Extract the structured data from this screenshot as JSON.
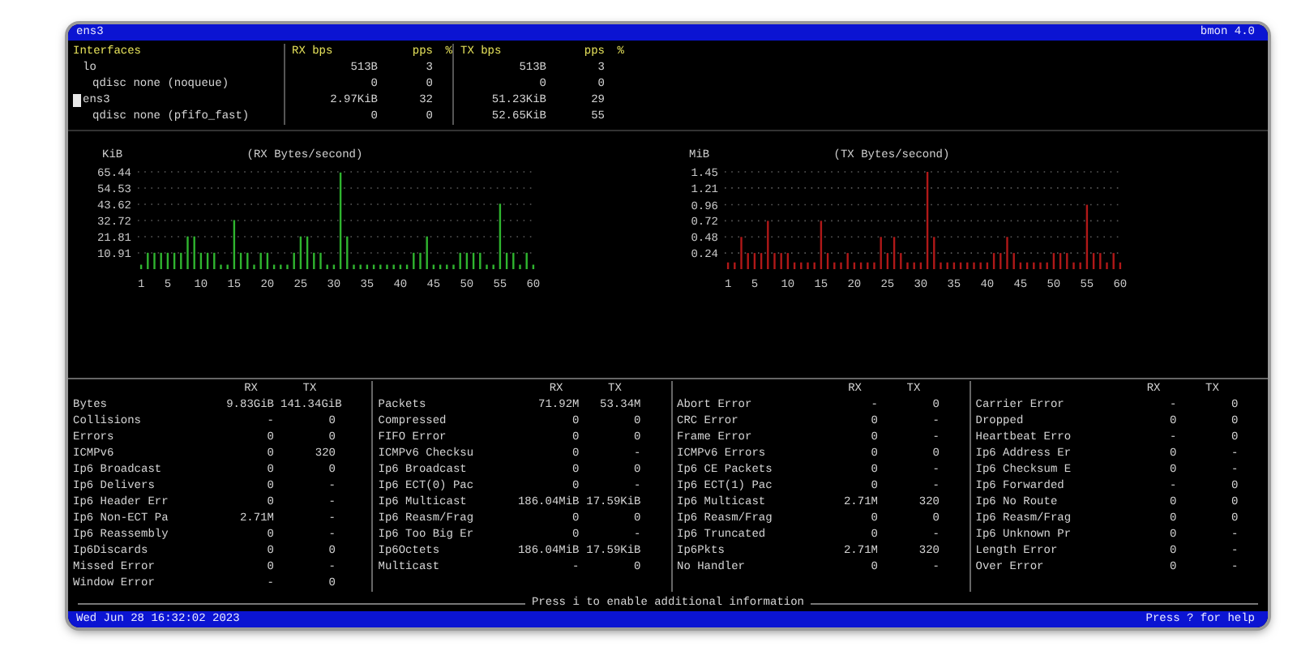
{
  "window": {
    "title": "ens3",
    "app": "bmon 4.0"
  },
  "interfaces": {
    "columns": [
      "Interfaces",
      "RX bps",
      "pps",
      "%",
      "TX bps",
      "pps",
      "%"
    ],
    "rows": [
      {
        "name": "lo",
        "selected": false,
        "rx_bps": "513B",
        "rx_pps": "3",
        "tx_bps": "513B",
        "tx_pps": "3",
        "children": [
          {
            "name": "qdisc none (noqueue)",
            "rx_bps": "0",
            "rx_pps": "0",
            "tx_bps": "0",
            "tx_pps": "0"
          }
        ]
      },
      {
        "name": "ens3",
        "selected": true,
        "rx_bps": "2.97KiB",
        "rx_pps": "32",
        "tx_bps": "51.23KiB",
        "tx_pps": "29",
        "children": [
          {
            "name": "qdisc none (pfifo_fast)",
            "rx_bps": "0",
            "rx_pps": "0",
            "tx_bps": "52.65KiB",
            "tx_pps": "55"
          }
        ]
      }
    ]
  },
  "graphs": [
    {
      "chart_data": {
        "type": "bar",
        "title": "(RX Bytes/second)",
        "ylabel": "KiB",
        "grid": true,
        "x": [
          1,
          2,
          3,
          4,
          5,
          6,
          7,
          8,
          9,
          10,
          11,
          12,
          13,
          14,
          15,
          16,
          17,
          18,
          19,
          20,
          21,
          22,
          23,
          24,
          25,
          26,
          27,
          28,
          29,
          30,
          31,
          32,
          33,
          34,
          35,
          36,
          37,
          38,
          39,
          40,
          41,
          42,
          43,
          44,
          45,
          46,
          47,
          48,
          49,
          50,
          51,
          52,
          53,
          54,
          55,
          56,
          57,
          58,
          59,
          60
        ],
        "xlim": [
          0.5,
          60.5
        ],
        "ylim": [
          0,
          65.44
        ],
        "yticks": [
          {
            "value": 65.44,
            "label": "65.44"
          },
          {
            "value": 54.53,
            "label": "54.53"
          },
          {
            "value": 43.62,
            "label": "43.62"
          },
          {
            "value": 32.72,
            "label": "32.72"
          },
          {
            "value": 21.81,
            "label": "21.81"
          },
          {
            "value": 10.91,
            "label": "10.91"
          }
        ],
        "xticks": [
          1,
          5,
          10,
          15,
          20,
          25,
          30,
          35,
          40,
          45,
          50,
          55,
          60
        ],
        "series": [
          {
            "color": "#2fb52f",
            "values": [
              3,
              11,
              11,
              11,
              11,
              11,
              11,
              22,
              22,
              11,
              11,
              11,
              3,
              3,
              33,
              11,
              11,
              3,
              11,
              11,
              3,
              3,
              3,
              11,
              22,
              22,
              11,
              11,
              3,
              3,
              65,
              22,
              3,
              3,
              3,
              3,
              3,
              3,
              3,
              3,
              3,
              11,
              11,
              22,
              3,
              3,
              3,
              3,
              11,
              11,
              11,
              11,
              3,
              3,
              44,
              11,
              11,
              3,
              11,
              3
            ]
          }
        ]
      }
    },
    {
      "chart_data": {
        "type": "bar",
        "title": "(TX Bytes/second)",
        "ylabel": "MiB",
        "grid": true,
        "x": [
          1,
          2,
          3,
          4,
          5,
          6,
          7,
          8,
          9,
          10,
          11,
          12,
          13,
          14,
          15,
          16,
          17,
          18,
          19,
          20,
          21,
          22,
          23,
          24,
          25,
          26,
          27,
          28,
          29,
          30,
          31,
          32,
          33,
          34,
          35,
          36,
          37,
          38,
          39,
          40,
          41,
          42,
          43,
          44,
          45,
          46,
          47,
          48,
          49,
          50,
          51,
          52,
          53,
          54,
          55,
          56,
          57,
          58,
          59,
          60
        ],
        "xlim": [
          0.5,
          60.5
        ],
        "ylim": [
          0,
          1.45
        ],
        "yticks": [
          {
            "value": 1.45,
            "label": "1.45"
          },
          {
            "value": 1.21,
            "label": "1.21"
          },
          {
            "value": 0.96,
            "label": "0.96"
          },
          {
            "value": 0.72,
            "label": "0.72"
          },
          {
            "value": 0.48,
            "label": "0.48"
          },
          {
            "value": 0.24,
            "label": "0.24"
          }
        ],
        "xticks": [
          1,
          5,
          10,
          15,
          20,
          25,
          30,
          35,
          40,
          45,
          50,
          55,
          60
        ],
        "series": [
          {
            "color": "#b01818",
            "values": [
              0.1,
              0.1,
              0.48,
              0.24,
              0.24,
              0.24,
              0.72,
              0.24,
              0.24,
              0.24,
              0.1,
              0.1,
              0.1,
              0.1,
              0.72,
              0.24,
              0.1,
              0.1,
              0.24,
              0.1,
              0.1,
              0.1,
              0.1,
              0.48,
              0.24,
              0.48,
              0.24,
              0.1,
              0.1,
              0.1,
              1.45,
              0.48,
              0.1,
              0.1,
              0.1,
              0.1,
              0.1,
              0.1,
              0.1,
              0.1,
              0.24,
              0.24,
              0.48,
              0.24,
              0.1,
              0.1,
              0.1,
              0.1,
              0.1,
              0.24,
              0.24,
              0.24,
              0.1,
              0.1,
              0.96,
              0.24,
              0.24,
              0.1,
              0.24,
              0.1
            ]
          }
        ]
      }
    }
  ],
  "stats": [
    {
      "columns": [
        "RX",
        "TX"
      ],
      "rows": [
        {
          "label": "Bytes",
          "rx": "9.83GiB",
          "tx": "141.34GiB"
        },
        {
          "label": "Collisions",
          "rx": "-",
          "tx": "0"
        },
        {
          "label": "Errors",
          "rx": "0",
          "tx": "0"
        },
        {
          "label": "ICMPv6",
          "rx": "0",
          "tx": "320"
        },
        {
          "label": "Ip6 Broadcast",
          "rx": "0",
          "tx": "0"
        },
        {
          "label": "Ip6 Delivers",
          "rx": "0",
          "tx": "-"
        },
        {
          "label": "Ip6 Header Err",
          "rx": "0",
          "tx": "-"
        },
        {
          "label": "Ip6 Non-ECT Pa",
          "rx": "2.71M",
          "tx": "-"
        },
        {
          "label": "Ip6 Reassembly",
          "rx": "0",
          "tx": "-"
        },
        {
          "label": "Ip6Discards",
          "rx": "0",
          "tx": "0"
        },
        {
          "label": "Missed Error",
          "rx": "0",
          "tx": "-"
        },
        {
          "label": "Window Error",
          "rx": "-",
          "tx": "0"
        }
      ]
    },
    {
      "columns": [
        "RX",
        "TX"
      ],
      "rows": [
        {
          "label": "Packets",
          "rx": "71.92M",
          "tx": "53.34M"
        },
        {
          "label": "Compressed",
          "rx": "0",
          "tx": "0"
        },
        {
          "label": "FIFO Error",
          "rx": "0",
          "tx": "0"
        },
        {
          "label": "ICMPv6 Checksu",
          "rx": "0",
          "tx": "-"
        },
        {
          "label": "Ip6 Broadcast",
          "rx": "0",
          "tx": "0"
        },
        {
          "label": "Ip6 ECT(0) Pac",
          "rx": "0",
          "tx": "-"
        },
        {
          "label": "Ip6 Multicast",
          "rx": "186.04MiB",
          "tx": "17.59KiB"
        },
        {
          "label": "Ip6 Reasm/Frag",
          "rx": "0",
          "tx": "0"
        },
        {
          "label": "Ip6 Too Big Er",
          "rx": "0",
          "tx": "-"
        },
        {
          "label": "Ip6Octets",
          "rx": "186.04MiB",
          "tx": "17.59KiB"
        },
        {
          "label": "Multicast",
          "rx": "-",
          "tx": "0"
        }
      ]
    },
    {
      "columns": [
        "RX",
        "TX"
      ],
      "rows": [
        {
          "label": "Abort Error",
          "rx": "-",
          "tx": "0"
        },
        {
          "label": "CRC Error",
          "rx": "0",
          "tx": "-"
        },
        {
          "label": "Frame Error",
          "rx": "0",
          "tx": "-"
        },
        {
          "label": "ICMPv6 Errors",
          "rx": "0",
          "tx": "0"
        },
        {
          "label": "Ip6 CE Packets",
          "rx": "0",
          "tx": "-"
        },
        {
          "label": "Ip6 ECT(1) Pac",
          "rx": "0",
          "tx": "-"
        },
        {
          "label": "Ip6 Multicast",
          "rx": "2.71M",
          "tx": "320"
        },
        {
          "label": "Ip6 Reasm/Frag",
          "rx": "0",
          "tx": "0"
        },
        {
          "label": "Ip6 Truncated",
          "rx": "0",
          "tx": "-"
        },
        {
          "label": "Ip6Pkts",
          "rx": "2.71M",
          "tx": "320"
        },
        {
          "label": "No Handler",
          "rx": "0",
          "tx": "-"
        }
      ]
    },
    {
      "columns": [
        "RX",
        "TX"
      ],
      "rows": [
        {
          "label": "Carrier Error",
          "rx": "-",
          "tx": "0"
        },
        {
          "label": "Dropped",
          "rx": "0",
          "tx": "0"
        },
        {
          "label": "Heartbeat Erro",
          "rx": "-",
          "tx": "0"
        },
        {
          "label": "Ip6 Address Er",
          "rx": "0",
          "tx": "-"
        },
        {
          "label": "Ip6 Checksum E",
          "rx": "0",
          "tx": "-"
        },
        {
          "label": "Ip6 Forwarded",
          "rx": "-",
          "tx": "0"
        },
        {
          "label": "Ip6 No Route",
          "rx": "0",
          "tx": "0"
        },
        {
          "label": "Ip6 Reasm/Frag",
          "rx": "0",
          "tx": "0"
        },
        {
          "label": "Ip6 Unknown Pr",
          "rx": "0",
          "tx": "-"
        },
        {
          "label": "Length Error",
          "rx": "0",
          "tx": "-"
        },
        {
          "label": "Over Error",
          "rx": "0",
          "tx": "-"
        }
      ]
    }
  ],
  "hint": "Press i to enable additional information",
  "status_bar": {
    "datetime": "Wed Jun 28 16:32:02 2023",
    "help": "Press ? for help"
  }
}
